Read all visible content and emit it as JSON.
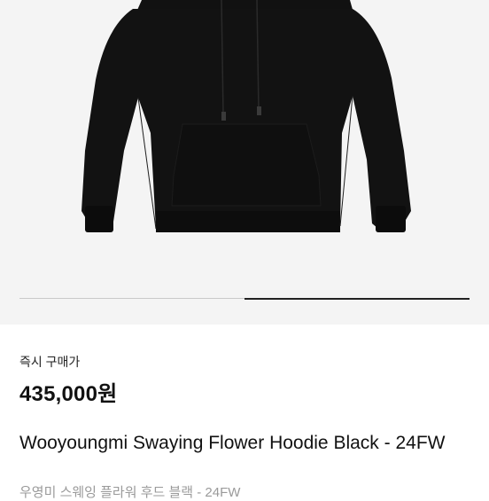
{
  "gallery": {
    "image_alt": "Black hoodie",
    "image_index": 2,
    "image_count": 2
  },
  "purchase": {
    "label": "즉시 구매가",
    "price": "435,000원"
  },
  "product": {
    "name_en": "Wooyoungmi Swaying Flower Hoodie Black - 24FW",
    "name_ko": "우영미 스웨잉 플라워 후드 블랙 - 24FW"
  }
}
